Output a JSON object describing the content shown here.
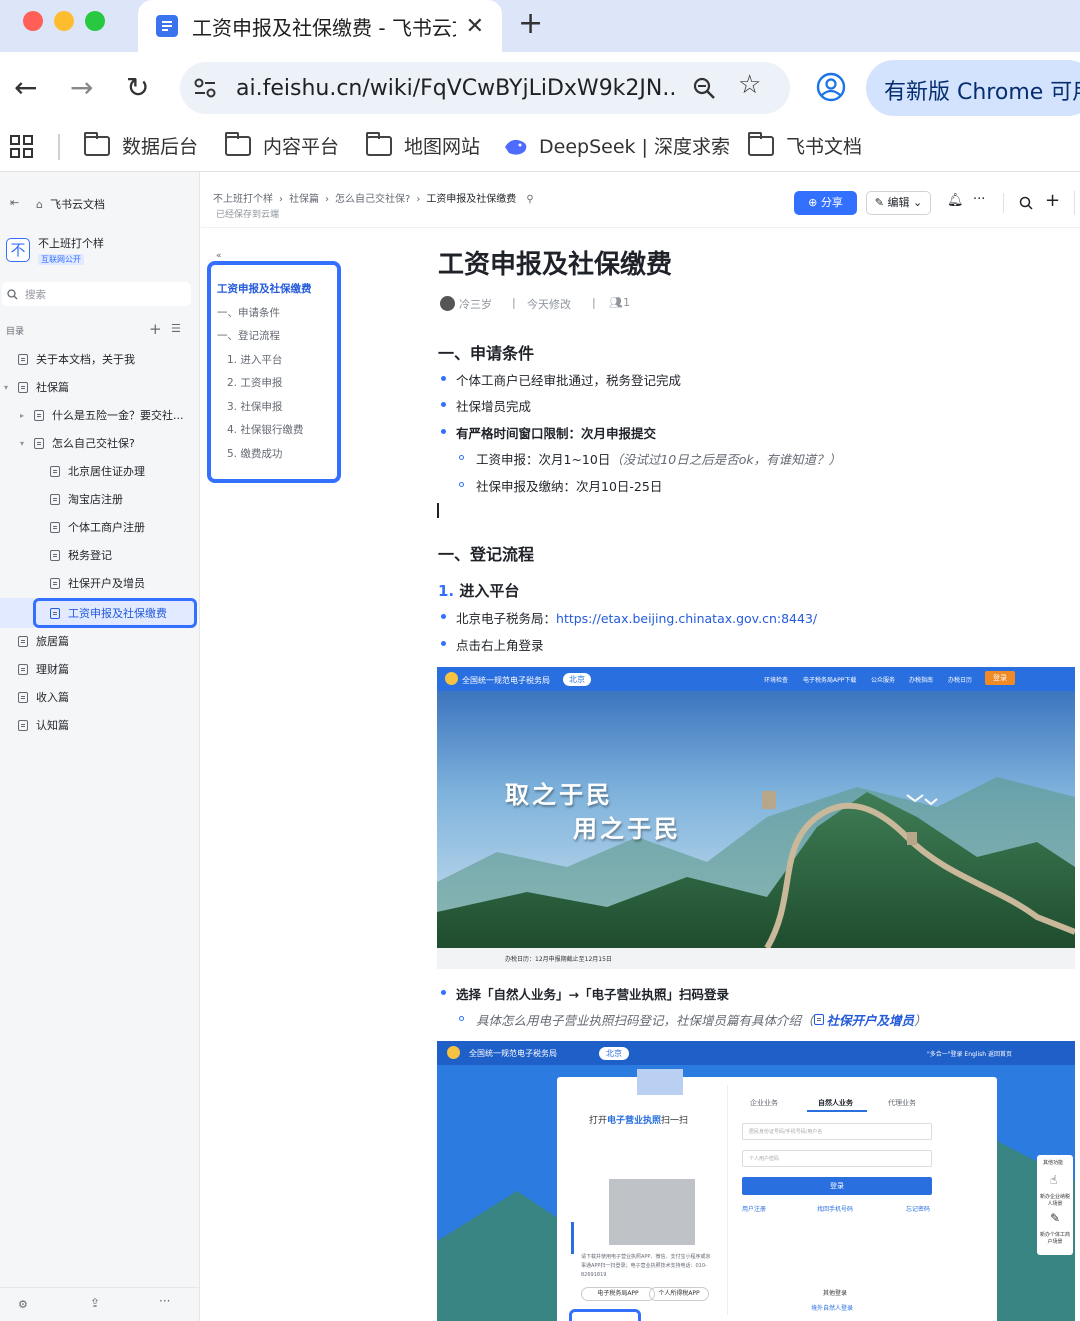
{
  "browser": {
    "tab_title": "工资申报及社保缴费 - 飞书云文",
    "url": "ai.feishu.cn/wiki/FqVCwBYjLiDxW9k2JN...",
    "update_label": "有新版 Chrome 可用",
    "bookmarks": [
      "数据后台",
      "内容平台",
      "地图网站",
      "DeepSeek | 深度求索",
      "飞书文档"
    ]
  },
  "sidebar": {
    "home": "飞书云文档",
    "space_name": "不上班打个样",
    "space_badge": "互联网公开",
    "search_placeholder": "搜索",
    "toc_label": "目录",
    "items": [
      "关于本文档，关于我",
      "社保篇",
      "什么是五险一金？要交社...",
      "怎么自己交社保?",
      "北京居住证办理",
      "淘宝店注册",
      "个体工商户注册",
      "税务登记",
      "社保开户及增员",
      "工资申报及社保缴费",
      "旅居篇",
      "理财篇",
      "收入篇",
      "认知篇"
    ]
  },
  "header": {
    "breadcrumb": [
      "不上班打个样",
      "社保篇",
      "怎么自己交社保?",
      "工资申报及社保缴费"
    ],
    "saved": "已经保存到云端",
    "share": "分享",
    "edit": "编辑"
  },
  "outline": {
    "title": "工资申报及社保缴费",
    "items": [
      "一、申请条件",
      "一、登记流程",
      "1. 进入平台",
      "2. 工资申报",
      "3. 社保申报",
      "4. 社保银行缴费",
      "5. 缴费成功"
    ]
  },
  "doc": {
    "title": "工资申报及社保缴费",
    "author": "冷三岁",
    "modified": "今天修改",
    "viewers": "1",
    "section1": "一、申请条件",
    "s1_items": [
      "个体工商户已经审批通过，税务登记完成",
      "社保增员完成",
      "有严格时间窗口限制：次月申报提交"
    ],
    "s1_sub1_a": "工资申报：次月1~10日",
    "s1_sub1_b": "（没试过10日之后是否ok，有谁知道？）",
    "s1_sub2": "社保申报及缴纳：次月10日-25日",
    "section2": "一、登记流程",
    "step1_num": "1.",
    "step1": "进入平台",
    "bj_prefix": "北京电子税务局：",
    "bj_link": "https://etax.beijing.chinatax.gov.cn:8443/",
    "login_hint": "点击右上角登录",
    "choose": "选择「自然人业务」→「电子营业执照」扫码登录",
    "detail_a": "具体怎么用电子营业执照扫码登记，社保增员篇有具体介绍（",
    "detail_link": "社保开户及增员",
    "detail_b": "）"
  },
  "shot1": {
    "site": "全国统一规范电子税务局",
    "region": "北京",
    "nav": [
      "环境检查",
      "电子税务局APP下载",
      "公众服务",
      "办税指南",
      "办税日历"
    ],
    "login": "登录",
    "slogan1": "取之于民",
    "slogan2": "用之于民",
    "footer": "办税日历：12月申报期截止至12月15日"
  },
  "shot2": {
    "site": "全国统一规范电子税务局",
    "region": "北京",
    "right_links": "\"多合一\"登录  English  返回首页",
    "qr_title_a": "打开",
    "qr_title_b": "电子营业执照",
    "qr_title_c": "扫一扫",
    "tabs": [
      "企业业务",
      "自然人业务",
      "代理业务"
    ],
    "id_placeholder": "居民身份证号码/手机号码/用户名",
    "pwd_placeholder": "个人用户密码",
    "login_btn": "登录",
    "register": "用户注册",
    "find_phone": "找回手机号码",
    "forgot": "忘记密码",
    "qr_note": "请下载并使用电子营业执照APP、微信、支付宝小程序或京事通APP扫一扫登录；电子营业执照技术支持电话：010-82691819",
    "app1": "电子税务局APP",
    "app2": "个人所得税APP",
    "other_login": "其他登录",
    "foreign": "境外自然人登录",
    "side_title": "其他功能",
    "side1": "新办企业纳税人场景",
    "side2": "新办个体工商户场景"
  }
}
